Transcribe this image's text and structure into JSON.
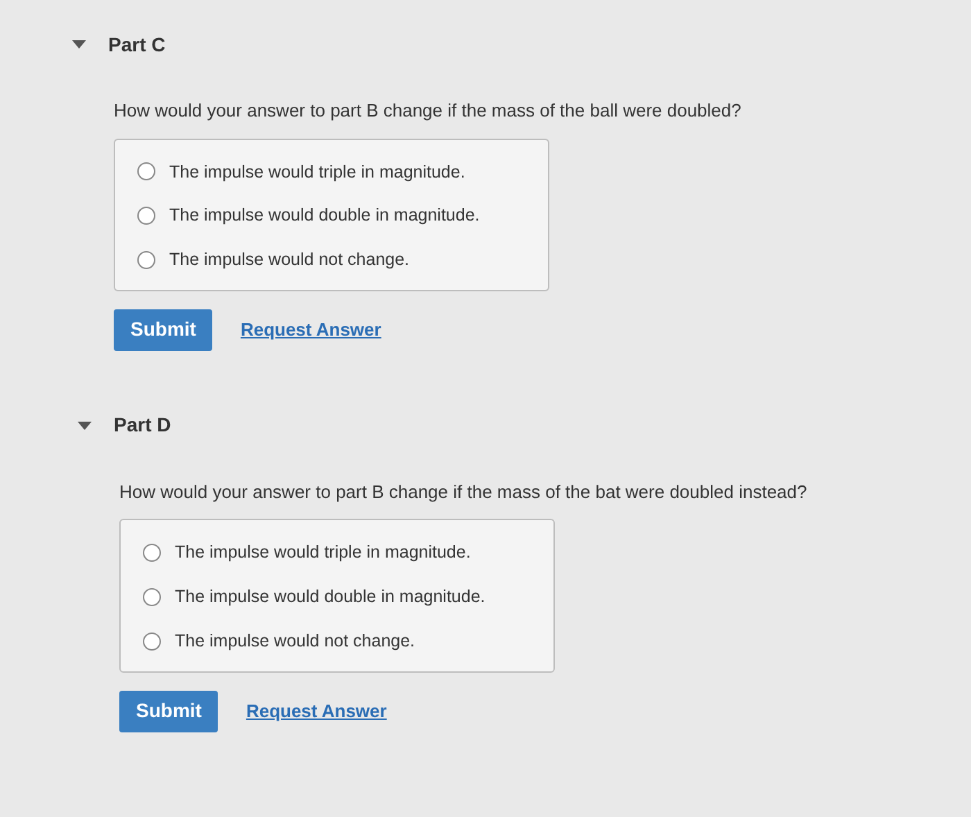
{
  "parts": [
    {
      "title": "Part C",
      "expanded": true,
      "question": "How would your answer to part B change if the mass of the ball were doubled?",
      "options": [
        {
          "label": "The impulse would triple in magnitude.",
          "selected": false
        },
        {
          "label": "The impulse would double in magnitude.",
          "selected": false
        },
        {
          "label": "The impulse would not change.",
          "selected": false
        }
      ],
      "submit": "Submit",
      "request": "Request Answer"
    },
    {
      "title": "Part D",
      "expanded": true,
      "question": "How would your answer to part B change if the mass of the bat were doubled instead?",
      "options": [
        {
          "label": "The impulse would triple in magnitude.",
          "selected": false
        },
        {
          "label": "The impulse would double in magnitude.",
          "selected": false
        },
        {
          "label": "The impulse would not change.",
          "selected": false
        }
      ],
      "submit": "Submit",
      "request": "Request Answer"
    }
  ]
}
